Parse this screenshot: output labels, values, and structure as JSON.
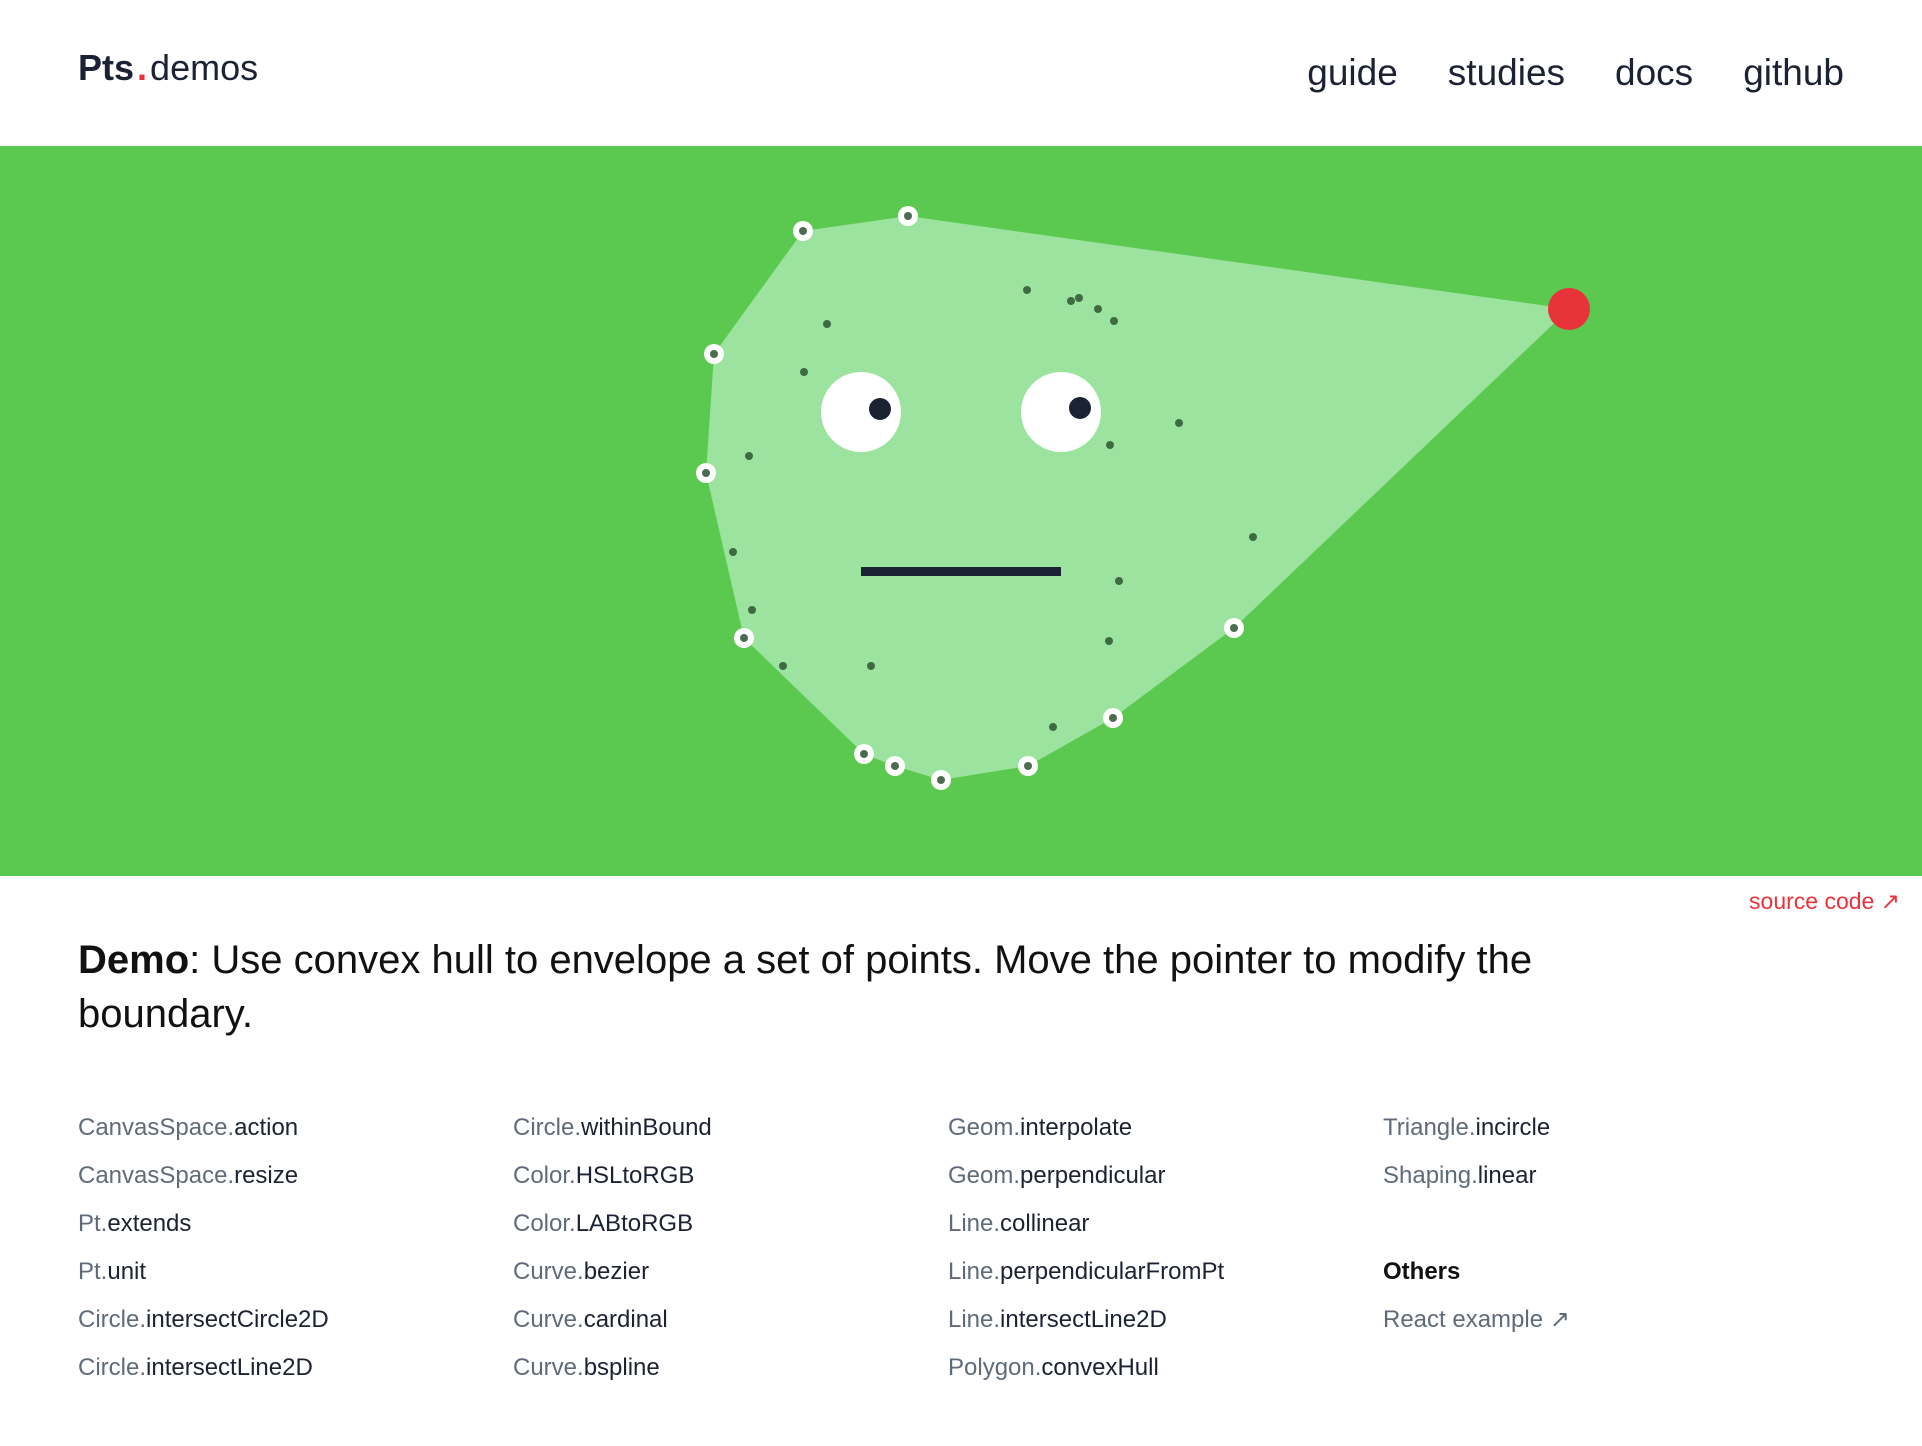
{
  "header": {
    "brand": "Pts",
    "brand_suffix": "demos",
    "nav": [
      {
        "label": "guide"
      },
      {
        "label": "studies"
      },
      {
        "label": "docs"
      },
      {
        "label": "github"
      }
    ]
  },
  "colors": {
    "canvas_bg": "#5bc94f",
    "hull_fill": "#9be39e",
    "pointer": "#e8333b",
    "dark": "#1b2233",
    "accent": "#e8333b"
  },
  "source_link": "source code ↗",
  "description": {
    "bold": "Demo",
    "text": ": Use convex hull to envelope a set of points. Move the pointer to modify the boundary."
  },
  "api_columns": [
    [
      {
        "cls": "CanvasSpace.",
        "fn": "action"
      },
      {
        "cls": "CanvasSpace.",
        "fn": "resize"
      },
      {
        "cls": "Pt.",
        "fn": "extends"
      },
      {
        "cls": "Pt.",
        "fn": "unit"
      },
      {
        "cls": "Circle.",
        "fn": "intersectCircle2D"
      },
      {
        "cls": "Circle.",
        "fn": "intersectLine2D"
      }
    ],
    [
      {
        "cls": "Circle.",
        "fn": "withinBound"
      },
      {
        "cls": "Color.",
        "fn": "HSLtoRGB"
      },
      {
        "cls": "Color.",
        "fn": "LABtoRGB"
      },
      {
        "cls": "Curve.",
        "fn": "bezier"
      },
      {
        "cls": "Curve.",
        "fn": "cardinal"
      },
      {
        "cls": "Curve.",
        "fn": "bspline"
      }
    ],
    [
      {
        "cls": "Geom.",
        "fn": "interpolate"
      },
      {
        "cls": "Geom.",
        "fn": "perpendicular"
      },
      {
        "cls": "Line.",
        "fn": "collinear"
      },
      {
        "cls": "Line.",
        "fn": "perpendicularFromPt"
      },
      {
        "cls": "Line.",
        "fn": "intersectLine2D"
      },
      {
        "cls": "Polygon.",
        "fn": "convexHull"
      }
    ],
    [
      {
        "cls": "Triangle.",
        "fn": "incircle"
      },
      {
        "cls": "Shaping.",
        "fn": "linear"
      }
    ]
  ],
  "others": {
    "title": "Others",
    "react_label": "React example ↗"
  }
}
